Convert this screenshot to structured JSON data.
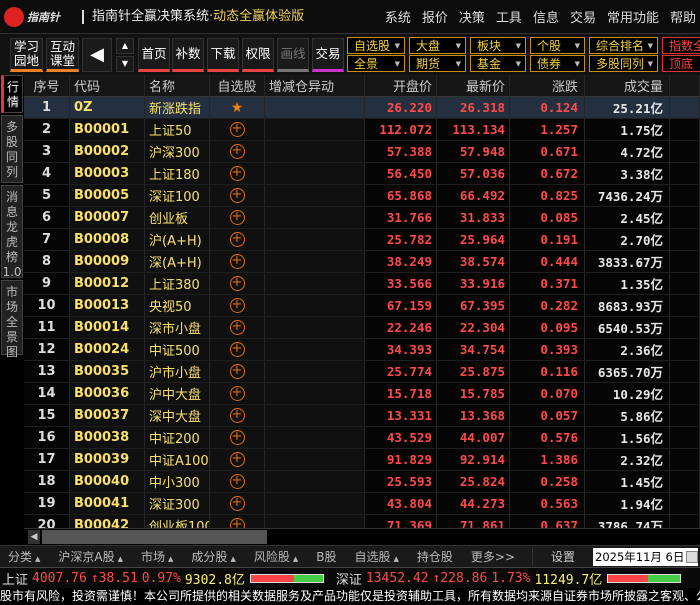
{
  "titlebar": {
    "logo_text": "指南针",
    "title": "指南针全赢决策系统",
    "subtitle": "·动态全赢体验版",
    "menu": [
      "系统",
      "报价",
      "决策",
      "工具",
      "信息",
      "交易",
      "常用功能",
      "帮助"
    ]
  },
  "toolbar": {
    "learn": "学习园地",
    "interact": "互动课堂",
    "buttons": [
      "首页",
      "补数",
      "下载",
      "权限",
      "画线",
      "交易"
    ],
    "selects_top": [
      "自选股",
      "大盘",
      "板块",
      "个股",
      "综合排名",
      "指数全"
    ],
    "selects_bottom": [
      "全景",
      "期货",
      "基金",
      "债券",
      "多股同列",
      "顶底"
    ]
  },
  "sidebar": [
    "行情",
    "多股同列",
    "消息龙虎榜1.0",
    "市场全景图"
  ],
  "columns": [
    "序号",
    "代码",
    "名称",
    "自选股",
    "增减仓异动",
    "开盘价",
    "最新价",
    "涨跌",
    "成交量"
  ],
  "rows": [
    [
      "1",
      "0Z",
      "新涨跌指",
      "26.220",
      "26.318",
      "0.124",
      "25.21亿"
    ],
    [
      "2",
      "B00001",
      "上证50",
      "112.072",
      "113.134",
      "1.257",
      "1.75亿"
    ],
    [
      "3",
      "B00002",
      "沪深300",
      "57.388",
      "57.948",
      "0.671",
      "4.72亿"
    ],
    [
      "4",
      "B00003",
      "上证180",
      "56.450",
      "57.036",
      "0.672",
      "3.38亿"
    ],
    [
      "5",
      "B00005",
      "深证100",
      "65.868",
      "66.492",
      "0.825",
      "7436.24万"
    ],
    [
      "6",
      "B00007",
      "创业板",
      "31.766",
      "31.833",
      "0.085",
      "2.45亿"
    ],
    [
      "7",
      "B00008",
      "沪(A+H)",
      "25.782",
      "25.964",
      "0.191",
      "2.70亿"
    ],
    [
      "8",
      "B00009",
      "深(A+H)",
      "38.249",
      "38.574",
      "0.444",
      "3833.67万"
    ],
    [
      "9",
      "B00012",
      "上证380",
      "33.566",
      "33.916",
      "0.371",
      "1.35亿"
    ],
    [
      "10",
      "B00013",
      "央视50",
      "67.159",
      "67.395",
      "0.282",
      "8683.93万"
    ],
    [
      "11",
      "B00014",
      "深市小盘",
      "22.246",
      "22.304",
      "0.095",
      "6540.53万"
    ],
    [
      "12",
      "B00024",
      "中证500",
      "34.393",
      "34.754",
      "0.393",
      "2.36亿"
    ],
    [
      "13",
      "B00035",
      "沪市小盘",
      "25.774",
      "25.875",
      "0.116",
      "6365.70万"
    ],
    [
      "14",
      "B00036",
      "沪中大盘",
      "15.718",
      "15.785",
      "0.070",
      "10.29亿"
    ],
    [
      "15",
      "B00037",
      "深中大盘",
      "13.331",
      "13.368",
      "0.057",
      "5.86亿"
    ],
    [
      "16",
      "B00038",
      "中证200",
      "43.529",
      "44.007",
      "0.576",
      "1.56亿"
    ],
    [
      "17",
      "B00039",
      "中证A100",
      "91.829",
      "92.914",
      "1.386",
      "2.32亿"
    ],
    [
      "18",
      "B00040",
      "中小300",
      "25.593",
      "25.824",
      "0.258",
      "1.45亿"
    ],
    [
      "19",
      "B00041",
      "深证300",
      "43.804",
      "44.273",
      "0.563",
      "1.94亿"
    ],
    [
      "20",
      "B00042",
      "创业板100",
      "71.369",
      "71.861",
      "0.637",
      "3786.74万"
    ]
  ],
  "bottom_tabs": [
    {
      "label": "分类",
      "arrow": true
    },
    {
      "label": "沪深京A股",
      "arrow": true
    },
    {
      "label": "市场",
      "arrow": true
    },
    {
      "label": "成分股",
      "arrow": true
    },
    {
      "label": "风险股",
      "arrow": true
    },
    {
      "label": "B股",
      "arrow": false
    },
    {
      "label": "自选股",
      "arrow": true
    },
    {
      "label": "持仓股",
      "arrow": false
    },
    {
      "label": "更多>>",
      "arrow": false
    }
  ],
  "settings": "设置",
  "date": "2025年11月 6日",
  "indices": [
    {
      "name": "上证",
      "value": "4007.76",
      "change": "↑38.51",
      "pct": "0.97%",
      "amount": "9302.8亿",
      "up_ratio": 0.6
    },
    {
      "name": "深证",
      "value": "13452.42",
      "change": "↑228.86",
      "pct": "1.73%",
      "amount": "11249.7亿",
      "up_ratio": 0.55
    }
  ],
  "ticker": "股市有风险，投资需谨慎！本公司所提供的相关数据服务及产品功能仅是投资辅助工具，所有数据均来源自证券市场所披露之客观、公",
  "colors": {
    "up": "#ff4a4a",
    "code": "#f8e070",
    "accent": "#c89010"
  }
}
